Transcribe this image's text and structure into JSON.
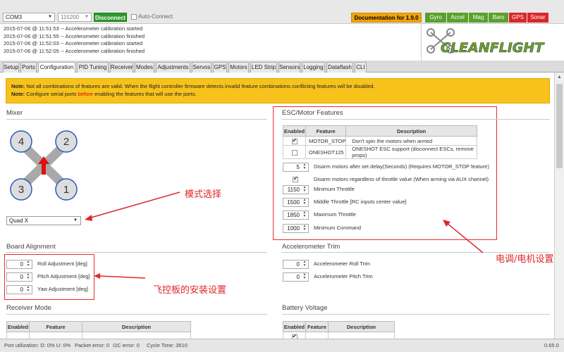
{
  "header": {
    "port": "COM3",
    "baud": "115200",
    "disconnect_label": "Disconnect",
    "auto_connect_label": "Auto-Connect",
    "documentation_label": "Documentation for 1.9.0",
    "sensors": [
      {
        "label": "Gyro",
        "color": "#5aa02c"
      },
      {
        "label": "Accel",
        "color": "#5aa02c"
      },
      {
        "label": "Mag",
        "color": "#5aa02c"
      },
      {
        "label": "Baro",
        "color": "#5aa02c"
      },
      {
        "label": "GPS",
        "color": "#d8282a"
      },
      {
        "label": "Sonar",
        "color": "#d8282a"
      }
    ]
  },
  "log": [
    "2015-07-06 @ 11:51:53 -- Accelerometer calibration started",
    "2015-07-06 @ 11:51:55 -- Accelerometer calibration finished",
    "2015-07-06 @ 11:52:03 -- Accelerometer calibration started",
    "2015-07-06 @ 11:52:05 -- Accelerometer calibration finished"
  ],
  "brand": {
    "name": "CLEANFLIGHT"
  },
  "tabs": [
    "Setup",
    "Ports",
    "Configuration",
    "PID Tuning",
    "Receiver",
    "Modes",
    "Adjustments",
    "Servos",
    "GPS",
    "Motors",
    "LED Strip",
    "Sensors",
    "Logging",
    "Dataflash",
    "CLI"
  ],
  "active_tab": "Configuration",
  "note": {
    "label1": "Note:",
    "text1": "Not all combinations of features are valid. When the flight controller firmware detects invalid feature combinations conflicting features will be disabled.",
    "label2": "Note:",
    "text2a": "Configure serial ports",
    "text2_red": "before",
    "text2b": "enabling the features that will use the ports."
  },
  "mixer": {
    "title": "Mixer",
    "motors": [
      "4",
      "2",
      "3",
      "1"
    ],
    "selected": "Quad X"
  },
  "esc": {
    "title": "ESC/Motor Features",
    "columns": [
      "Enabled",
      "Feature",
      "Description"
    ],
    "rows": [
      {
        "enabled": true,
        "feature": "MOTOR_STOP",
        "description": "Don't spin the motors when armed"
      },
      {
        "enabled": false,
        "feature": "ONESHOT125",
        "description": "ONESHOT ESC support (disconnect ESCs, remove props)"
      }
    ],
    "disarm_delay": {
      "value": "5",
      "label": "Disarm motors after set delay(Seconds) (Requires MOTOR_STOP feature)"
    },
    "disarm_regardless": {
      "checked": true,
      "label": "Disarm motors regardless of throttle value (When arming via AUX channel)"
    },
    "minimum_throttle": {
      "value": "1150",
      "label": "Minimum Throttle"
    },
    "middle_throttle": {
      "value": "1500",
      "label": "Middle Throttle [RC inputs center value]"
    },
    "maximum_throttle": {
      "value": "1850",
      "label": "Maximum Throttle"
    },
    "minimum_command": {
      "value": "1000",
      "label": "Minimum Command"
    }
  },
  "board_alignment": {
    "title": "Board Alignment",
    "roll": {
      "value": "0",
      "label": "Roll Adjustment [deg]"
    },
    "pitch": {
      "value": "0",
      "label": "Pitch Adjustment [deg]"
    },
    "yaw": {
      "value": "0",
      "label": "Yaw Adjustment [deg]"
    }
  },
  "accel_trim": {
    "title": "Accelerometer Trim",
    "roll": {
      "value": "0",
      "label": "Accelerometer Roll Trim"
    },
    "pitch": {
      "value": "0",
      "label": "Accelerometer Pitch Trim"
    }
  },
  "receiver_mode": {
    "title": "Receiver Mode",
    "columns": [
      "Enabled",
      "Feature",
      "Description"
    ]
  },
  "battery_voltage": {
    "title": "Battery Voltage",
    "columns": [
      "Enabled",
      "Feature",
      "Description"
    ]
  },
  "annotations": {
    "mode_select": "模式选择",
    "esc_settings": "电调/电机设置",
    "board_install": "飞控板的安装设置"
  },
  "status": {
    "port_util": "Port utilization: D: 0% U: 0%",
    "packet_error": "Packet error: 0",
    "i2c_error": "I2C error: 0",
    "cycle_time": "Cycle Time: 3510",
    "version": "0.65.0"
  }
}
